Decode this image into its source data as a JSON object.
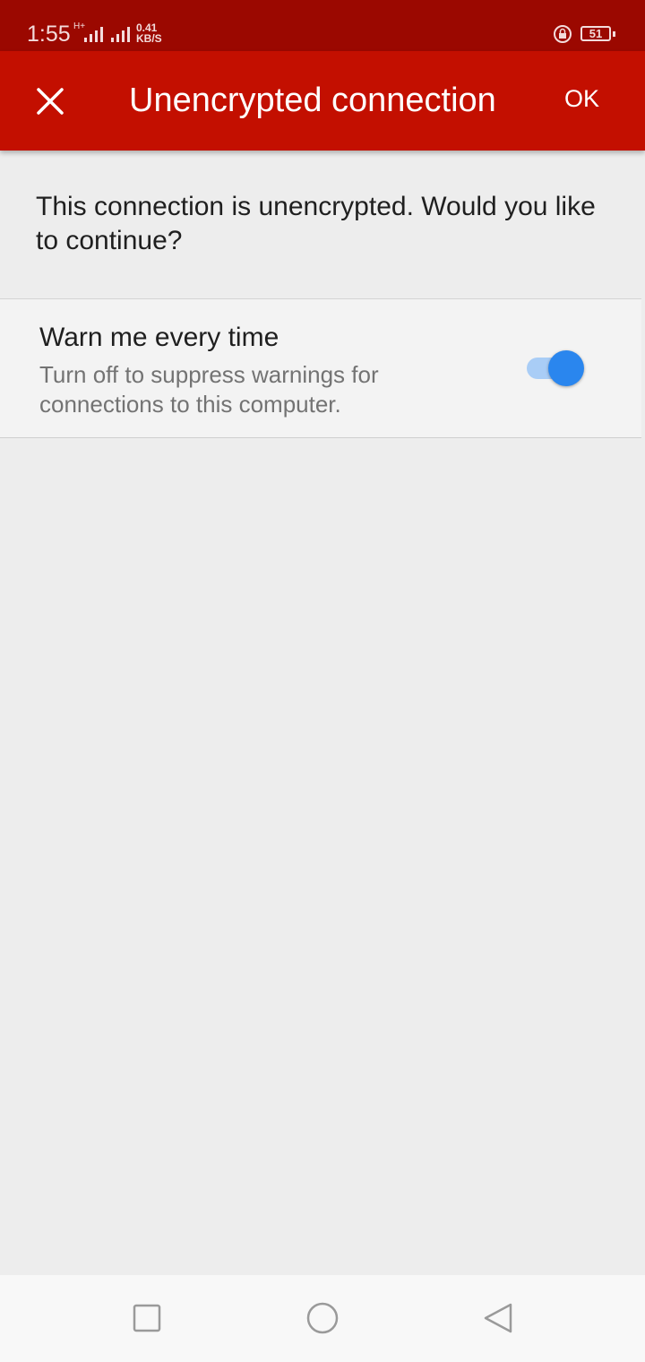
{
  "status_bar": {
    "time": "1:55",
    "network_type": "H+",
    "speed_value": "0.41",
    "speed_unit": "KB/S",
    "battery_level": "51",
    "icons": [
      "signal-icon",
      "signal-icon",
      "rotation-lock-icon",
      "battery-icon"
    ]
  },
  "app_bar": {
    "title": "Unencrypted connection",
    "ok_label": "OK",
    "close_icon": "close-icon",
    "background": "#c30f00"
  },
  "message": "This connection is unencrypted. Would you like to continue?",
  "setting": {
    "title": "Warn me every time",
    "description": "Turn off to suppress warnings for connections to this computer.",
    "enabled": true,
    "accent": "#2a86ee"
  },
  "nav_bar": {
    "icons": [
      "recents-icon",
      "home-icon",
      "back-icon"
    ]
  }
}
